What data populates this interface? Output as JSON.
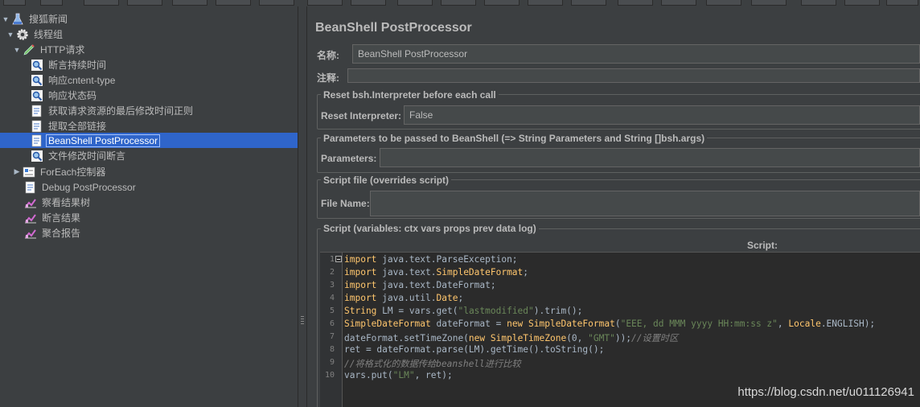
{
  "tree": {
    "items": [
      {
        "label": "搜狐新闻",
        "icon": "test-plan-flask-icon"
      },
      {
        "label": "线程组",
        "icon": "thread-group-gear-icon"
      },
      {
        "label": "HTTP请求",
        "icon": "http-sampler-pen-icon"
      },
      {
        "label": "断言持续时间",
        "icon": "assertion-magnifier-icon"
      },
      {
        "label": "响应cntent-type",
        "icon": "assertion-magnifier-icon"
      },
      {
        "label": "响应状态码",
        "icon": "assertion-magnifier-icon"
      },
      {
        "label": "获取请求资源的最后修改时间正则",
        "icon": "extractor-document-icon"
      },
      {
        "label": "提取全部链接",
        "icon": "extractor-document-icon"
      },
      {
        "label": "BeanShell PostProcessor",
        "icon": "postprocessor-document-icon"
      },
      {
        "label": "文件修改时间断言",
        "icon": "assertion-magnifier-icon"
      },
      {
        "label": "ForEach控制器",
        "icon": "foreach-controller-icon"
      },
      {
        "label": "Debug PostProcessor",
        "icon": "postprocessor-document-icon"
      },
      {
        "label": "察看结果树",
        "icon": "listener-chart-icon"
      },
      {
        "label": "断言结果",
        "icon": "listener-chart-icon"
      },
      {
        "label": "聚合报告",
        "icon": "listener-chart-icon"
      }
    ]
  },
  "panel": {
    "title": "BeanShell PostProcessor",
    "name_label": "名称:",
    "name_value": "BeanShell PostProcessor",
    "comment_label": "注释:",
    "comment_value": "",
    "reset_group_title": "Reset bsh.Interpreter before each call",
    "reset_label": "Reset Interpreter:",
    "reset_value": "False",
    "params_group_title": "Parameters to be passed to BeanShell (=> String Parameters and String []bsh.args)",
    "params_label": "Parameters:",
    "params_value": "",
    "file_group_title": "Script file (overrides script)",
    "file_label": "File Name:",
    "file_value": "",
    "script_group_title": "Script (variables: ctx vars props prev data log)",
    "script_label": "Script:"
  },
  "script_lines": [
    "import java.text.ParseException;",
    "import java.text.SimpleDateFormat;",
    "import java.text.DateFormat;",
    "import java.util.Date;",
    "String LM = vars.get(\"lastmodified\").trim();",
    "SimpleDateFormat dateFormat = new SimpleDateFormat(\"EEE, dd MMM yyyy HH:mm:ss z\", Locale.ENGLISH);",
    "dateFormat.setTimeZone(new SimpleTimeZone(0, \"GMT\"));//设置时区",
    "ret = dateFormat.parse(LM).getTime().toString();",
    "//将格式化的数据传给beanshell进行比较",
    "vars.put(\"LM\", ret);"
  ],
  "line_numbers": [
    "1",
    "2",
    "3",
    "4",
    "5",
    "6",
    "7",
    "8",
    "9",
    "10"
  ],
  "watermark": "https://blog.csdn.net/u011126941",
  "colors": {
    "background": "#3c3f41",
    "selection": "#2f65ca",
    "editor_bg": "#2b2b2b",
    "keyword": "#ffc66d",
    "string": "#6a8759",
    "comment": "#808080"
  }
}
